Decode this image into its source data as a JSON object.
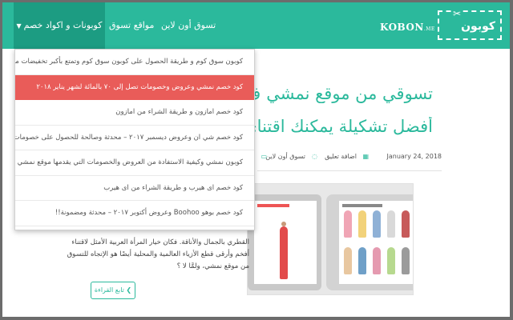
{
  "header": {
    "logo_text": "كوبون",
    "site_name": "KOBON",
    "site_tld": ".ME",
    "nav": {
      "online_shopping": "تسوق أون لاين",
      "shopping_sites": "مواقع تسوق",
      "coupons": "كوبونات و اكواد خصم"
    }
  },
  "dropdown": {
    "items": [
      "كوبون سوق كوم و طريقة الحصول على كوبون سوق كوم وتمتع بأكبر تخفيضات ممكنة",
      "كود خصم نمشي وعروض وخصومات تصل إلى ٧٠ بالمائة لشهر يناير ٢٠١٨",
      "كود خصم امازون و طريقة الشراء من امازون",
      "كود خصم شي ان وعروض ديسمبر ٢٠١٧ – محدثة وصالحة للحصول على خصومات فورية!",
      "كوبون نمشي وكيفية الاستفادة من العروض والخصومات التي يقدمها موقع نمشي",
      "كود خصم اى هيرب و طريقة الشراء من اى هيرب",
      "كود خصم بوهو Boohoo وعروض أكتوبر ٢٠١٧ – محدثة ومضمونة!!"
    ],
    "active_index": 1
  },
  "article": {
    "title_line1": "تسوقي من موقع نمشي ف",
    "title_line2": "أفضل تشكيلة يمكنك اقتنائ",
    "date": "January 24, 2018",
    "comments": "اضافة تعليق",
    "category": "تسوق أون لاين",
    "body": "القطري بالجمال والأناقة. فكان خيار المرأة العربية الأمثل لاقتناء أفخم وأرقى قطع الأزياء العالمية والمحلية أيضًا هو الإتجاه للتسوق من موقع نمشي، ولمَّا لا ؟",
    "read_more": "تابع القراءة ❮"
  },
  "colors": {
    "brand": "#2bb99c",
    "nav_active": "#1c9c82",
    "highlight": "#e95c59"
  }
}
